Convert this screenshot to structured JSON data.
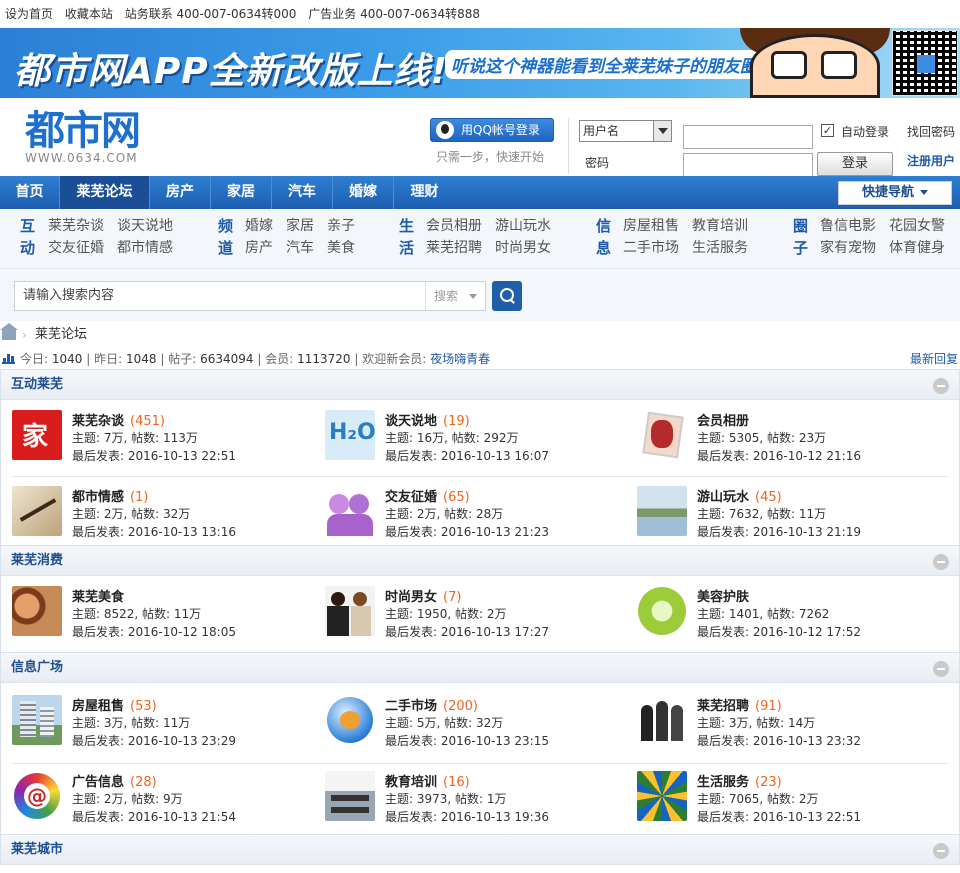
{
  "topbar": {
    "items": [
      "设为首页",
      "收藏本站",
      "站务联系  400-007-0634转000",
      "广告业务  400-007-0634转888"
    ]
  },
  "banner": {
    "title": "都市网APP全新改版上线!",
    "subtitle": "听说这个神器能看到全莱芜妹子的朋友圈"
  },
  "logo": {
    "text": "都市网",
    "sub": "WWW.0634.COM"
  },
  "login": {
    "qq_button": "用QQ帐号登录",
    "qq_tip": "只需一步，快速开始",
    "username_select": "用户名",
    "password_label": "密码",
    "auto_login": "自动登录",
    "login_button": "登录",
    "forgot": "找回密码",
    "register": "注册用户"
  },
  "nav": {
    "items": [
      "首页",
      "莱芜论坛",
      "房产",
      "家居",
      "汽车",
      "婚嫁",
      "理财"
    ],
    "active": "莱芜论坛",
    "quick": "快捷导航"
  },
  "links": [
    {
      "head": "互动",
      "items": [
        "莱芜杂谈",
        "谈天说地",
        "交友征婚",
        "都市情感"
      ]
    },
    {
      "head": "频道",
      "items": [
        "婚嫁",
        "家居",
        "亲子",
        "房产",
        "汽车",
        "美食"
      ]
    },
    {
      "head": "生活",
      "items": [
        "会员相册",
        "游山玩水",
        "莱芜招聘",
        "时尚男女"
      ]
    },
    {
      "head": "信息",
      "items": [
        "房屋租售",
        "教育培训",
        "二手市场",
        "生活服务"
      ]
    },
    {
      "head": "圈子",
      "items": [
        "鲁信电影",
        "花园女警",
        "家有宠物",
        "体育健身"
      ]
    }
  ],
  "search": {
    "placeholder": "请输入搜索内容",
    "type": "搜索"
  },
  "breadcrumb": {
    "current": "莱芜论坛"
  },
  "stats": {
    "today_label": "今日:",
    "today": "1040",
    "yesterday_label": "昨日:",
    "yesterday": "1048",
    "posts_label": "帖子:",
    "posts": "6634094",
    "members_label": "会员:",
    "members": "1113720",
    "welcome_label": "欢迎新会员:",
    "new_member": "夜场嗨青春",
    "latest": "最新回复"
  },
  "categories": [
    {
      "title": "互动莱芜",
      "forums": [
        {
          "name": "莱芜杂谈",
          "count": "(451)",
          "stats": "主题: 7万, 帖数: 113万",
          "last": "最后发表: 2016-10-13 22:51",
          "icon": "house-red-icon"
        },
        {
          "name": "谈天说地",
          "count": "(19)",
          "stats": "主题: 16万, 帖数: 292万",
          "last": "最后发表: 2016-10-13 16:07",
          "icon": "h2o-icon"
        },
        {
          "name": "会员相册",
          "count": "",
          "stats": "主题: 5305, 帖数: 23万",
          "last": "最后发表: 2016-10-12 21:16",
          "icon": "photo-album-icon"
        },
        {
          "name": "都市情感",
          "count": "(1)",
          "stats": "主题: 2万, 帖数: 32万",
          "last": "最后发表: 2016-10-13 13:16",
          "icon": "pen-writing-icon"
        },
        {
          "name": "交友征婚",
          "count": "(65)",
          "stats": "主题: 2万, 帖数: 28万",
          "last": "最后发表: 2016-10-13 21:23",
          "icon": "couple-icon"
        },
        {
          "name": "游山玩水",
          "count": "(45)",
          "stats": "主题: 7632, 帖数: 11万",
          "last": "最后发表: 2016-10-13 21:19",
          "icon": "landscape-icon"
        }
      ]
    },
    {
      "title": "莱芜消费",
      "forums": [
        {
          "name": "莱芜美食",
          "count": "",
          "stats": "主题: 8522, 帖数: 11万",
          "last": "最后发表: 2016-10-12 18:05",
          "icon": "food-icon"
        },
        {
          "name": "时尚男女",
          "count": "(7)",
          "stats": "主题: 1950, 帖数: 2万",
          "last": "最后发表: 2016-10-13 17:27",
          "icon": "fashion-icon"
        },
        {
          "name": "美容护肤",
          "count": "",
          "stats": "主题: 1401, 帖数: 7262",
          "last": "最后发表: 2016-10-12 17:52",
          "icon": "lime-icon"
        }
      ]
    },
    {
      "title": "信息广场",
      "forums": [
        {
          "name": "房屋租售",
          "count": "(53)",
          "stats": "主题: 3万, 帖数: 11万",
          "last": "最后发表: 2016-10-13 23:29",
          "icon": "building-icon"
        },
        {
          "name": "二手市场",
          "count": "(200)",
          "stats": "主题: 5万, 帖数: 32万",
          "last": "最后发表: 2016-10-13 23:15",
          "icon": "globe-people-icon"
        },
        {
          "name": "莱芜招聘",
          "count": "(91)",
          "stats": "主题: 3万, 帖数: 14万",
          "last": "最后发表: 2016-10-13 23:32",
          "icon": "business-people-icon"
        },
        {
          "name": "广告信息",
          "count": "(28)",
          "stats": "主题: 2万, 帖数: 9万",
          "last": "最后发表: 2016-10-13 21:54",
          "icon": "at-sign-icon"
        },
        {
          "name": "教育培训",
          "count": "(16)",
          "stats": "主题: 3973, 帖数: 1万",
          "last": "最后发表: 2016-10-13 19:36",
          "icon": "classroom-icon"
        },
        {
          "name": "生活服务",
          "count": "(23)",
          "stats": "主题: 7065, 帖数: 2万",
          "last": "最后发表: 2016-10-13 22:51",
          "icon": "spiral-icon"
        }
      ]
    },
    {
      "title": "莱芜城市",
      "forums": []
    }
  ]
}
